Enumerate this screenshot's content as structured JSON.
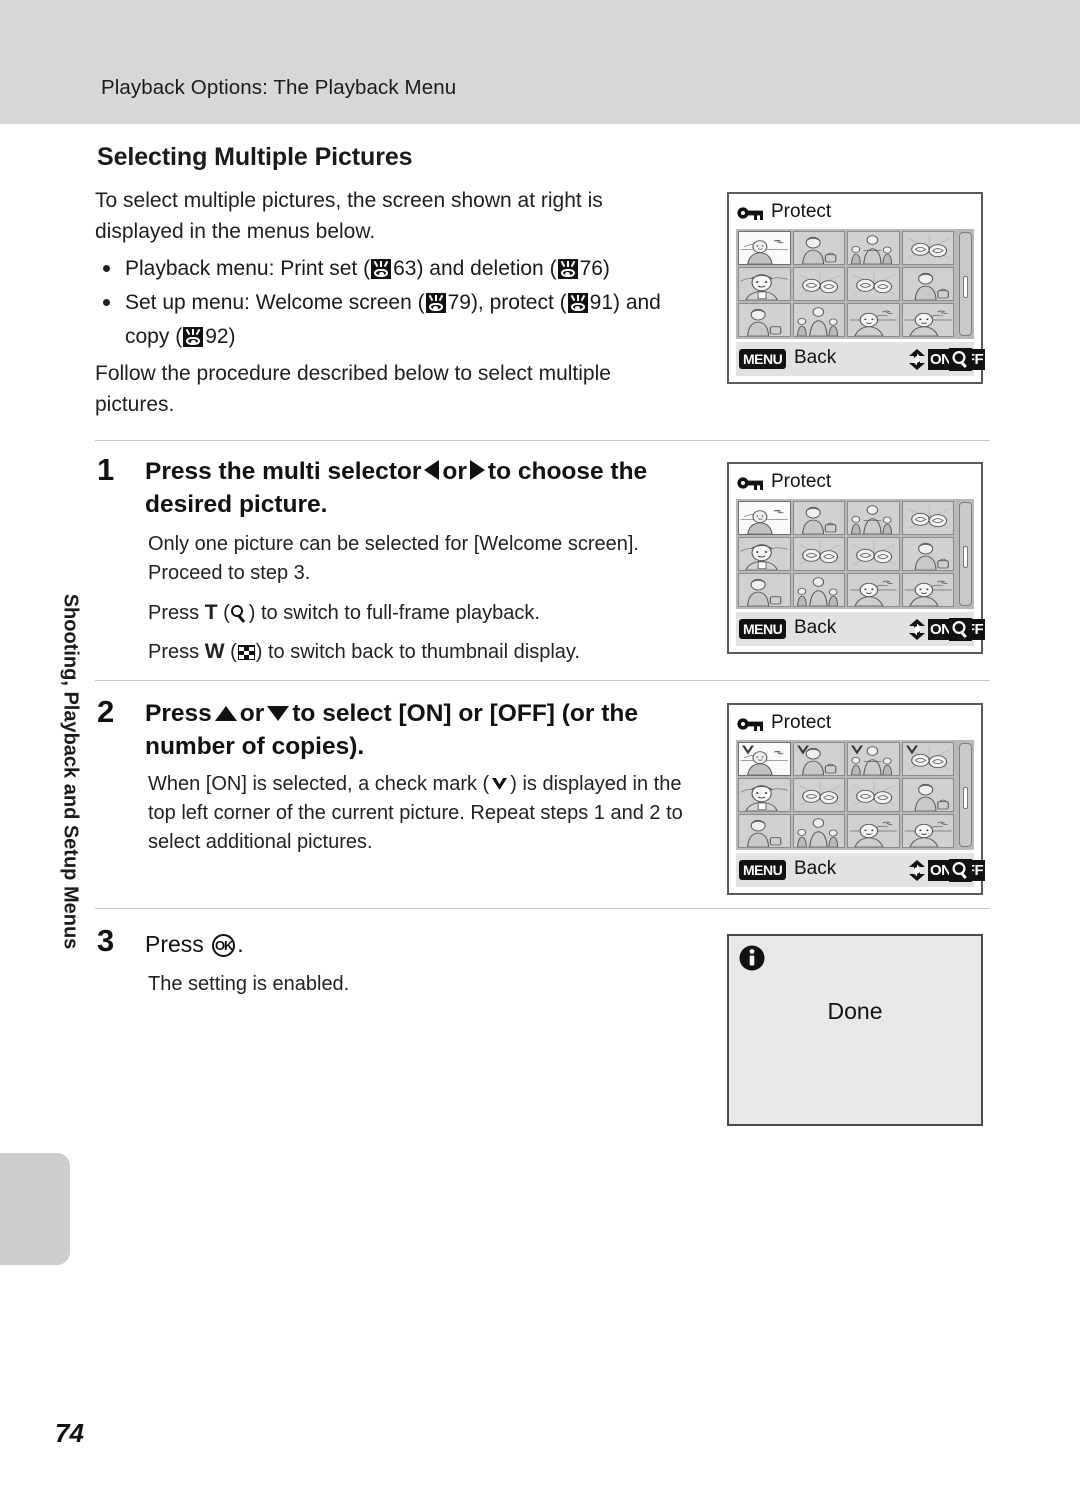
{
  "header": {
    "breadcrumb": "Playback Options: The Playback Menu"
  },
  "page": {
    "number": "74",
    "side_tab": "Shooting, Playback and Setup Menus"
  },
  "section": {
    "title": "Selecting Multiple Pictures",
    "intro": "To select multiple pictures, the screen shown at right is displayed in the menus below.",
    "bullets": [
      {
        "prefix": "Playback menu: Print set (",
        "ref1": "63",
        "mid": ") and deletion (",
        "ref2": "76",
        "suffix": ")"
      },
      {
        "prefix": "Set up menu: Welcome screen (",
        "ref1": "79",
        "mid": "), protect (",
        "ref2": "91",
        "mid2": ") and copy (",
        "ref3": "92",
        "suffix": ")"
      }
    ],
    "follow": "Follow the procedure described below to select multiple pictures."
  },
  "steps": [
    {
      "number": "1",
      "head_part1": "Press the multi selector",
      "head_or": "or",
      "head_part2": "to choose the desired picture.",
      "body_lines": [
        "Only one picture can be selected for [Welcome screen]. Proceed to step 3.",
        "Press T (   ) to switch to full-frame playback.",
        "Press W (   ) to switch back to thumbnail display."
      ],
      "body1": "Only one picture can be selected for [Welcome screen]. Proceed to step 3.",
      "body2_pre": "Press",
      "body2_key": "T",
      "body2_post": ") to switch to full-frame playback.",
      "body3_pre": "Press",
      "body3_key": "W",
      "body3_post": ") to switch back to thumbnail display."
    },
    {
      "number": "2",
      "head_pre": "Press",
      "head_or": "or",
      "head_post": "to select [ON] or [OFF] (or the number of copies).",
      "body_pre": "When [ON] is selected, a check mark (",
      "body_post": ") is displayed in the top left corner of the current picture. Repeat steps 1 and 2 to select additional pictures."
    },
    {
      "number": "3",
      "head_pre": "Press",
      "head_post": ".",
      "body": "The setting is enabled."
    }
  ],
  "screens": [
    {
      "id": "protect-1",
      "title": "Protect",
      "bottom": {
        "menu": "MENU",
        "back": "Back",
        "onoff": "ON/OFF"
      },
      "selected_index": 0,
      "checked_indexes": []
    },
    {
      "id": "protect-2",
      "title": "Protect",
      "bottom": {
        "menu": "MENU",
        "back": "Back",
        "onoff": "ON/OFF"
      },
      "selected_index": 0,
      "checked_indexes": []
    },
    {
      "id": "protect-3",
      "title": "Protect",
      "bottom": {
        "menu": "MENU",
        "back": "Back",
        "onoff": "ON/OFF"
      },
      "selected_index": 0,
      "checked_indexes": [
        0,
        1,
        2,
        3
      ]
    }
  ],
  "done_screen": {
    "label": "Done"
  },
  "colors": {
    "header_band": "#d7d7d7",
    "side_tab": "#cdcdcd",
    "rule": "#c9c9c9",
    "screen_border": "#5a5a5a",
    "thumb_bg": "#d0d0d0",
    "thumb_selected_bg": "#fafafa",
    "grid_bg": "#b9b9b9",
    "bottom_bar": "#e2e2e2",
    "done_bg": "#e8e8e8"
  }
}
